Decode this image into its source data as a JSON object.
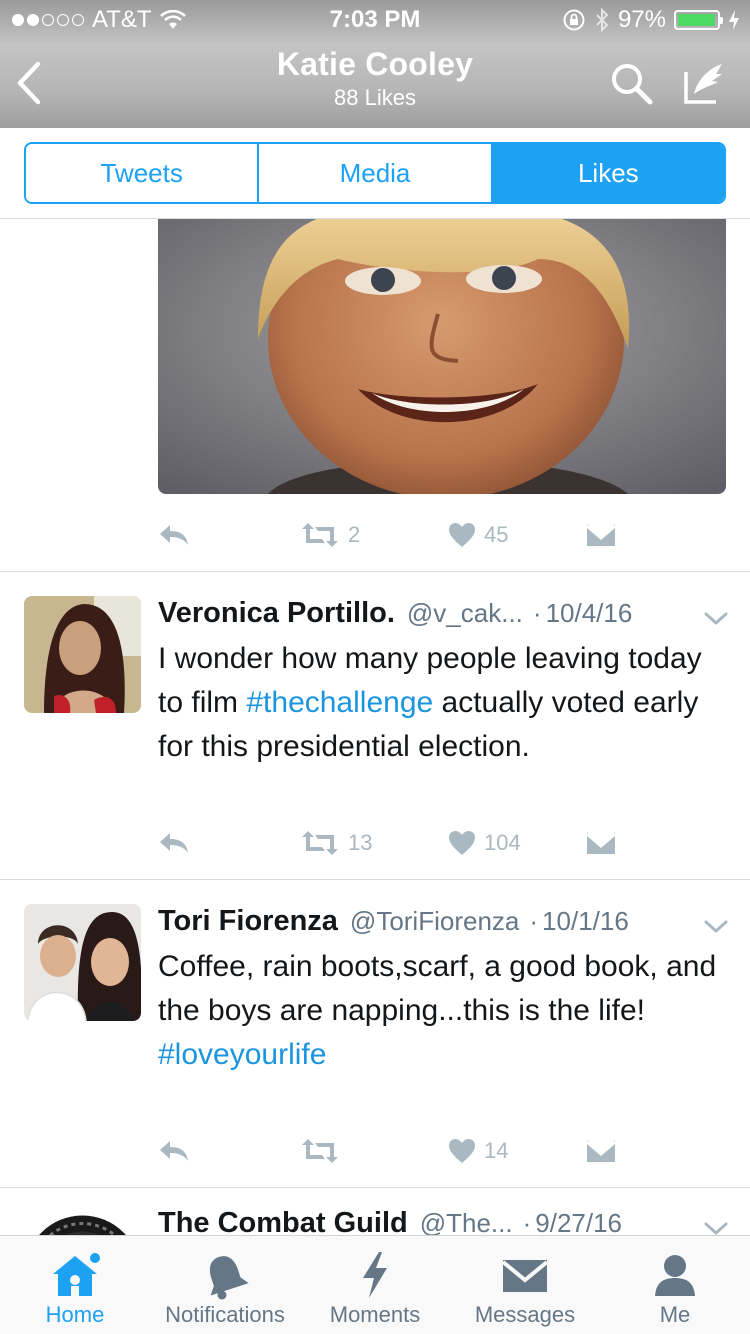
{
  "status_bar": {
    "carrier": "AT&T",
    "time": "7:03 PM",
    "battery_percent": "97%",
    "battery_level": 0.97
  },
  "header": {
    "title": "Katie Cooley",
    "subtitle": "88 Likes"
  },
  "segments": {
    "tweets": "Tweets",
    "media": "Media",
    "likes": "Likes",
    "active": "Likes"
  },
  "first_tweet": {
    "retweets": "2",
    "likes": "45"
  },
  "tweets": [
    {
      "name": "Veronica Portillo.",
      "handle": "@v_cak...",
      "date": "10/4/16",
      "text_parts": [
        "I wonder how many people leaving today to film ",
        "#thechallenge",
        " actually voted early for this presidential election."
      ],
      "retweets": "13",
      "likes": "104"
    },
    {
      "name": "Tori Fiorenza",
      "handle": "@ToriFiorenza",
      "date": "10/1/16",
      "text_parts": [
        "Coffee, rain boots,scarf, a good book, and the boys are napping...this is the life! ",
        "#loveyourlife"
      ],
      "retweets": "",
      "likes": "14"
    },
    {
      "name": "The Combat Guild",
      "handle": "@The...",
      "date": "9/27/16"
    }
  ],
  "tabbar": {
    "home": "Home",
    "notifications": "Notifications",
    "moments": "Moments",
    "messages": "Messages",
    "me": "Me",
    "active": "Home"
  },
  "colors": {
    "accent": "#1da1f2",
    "hashtag": "#1b95e0",
    "action_gray": "#aab8c2",
    "battery_green": "#4cd964"
  },
  "icons": [
    "back-chevron-icon",
    "search-icon",
    "compose-icon",
    "reply-icon",
    "retweet-icon",
    "heart-icon",
    "direct-message-icon",
    "chevron-down-icon",
    "home-icon",
    "bell-icon",
    "lightning-icon",
    "envelope-icon",
    "person-icon"
  ]
}
